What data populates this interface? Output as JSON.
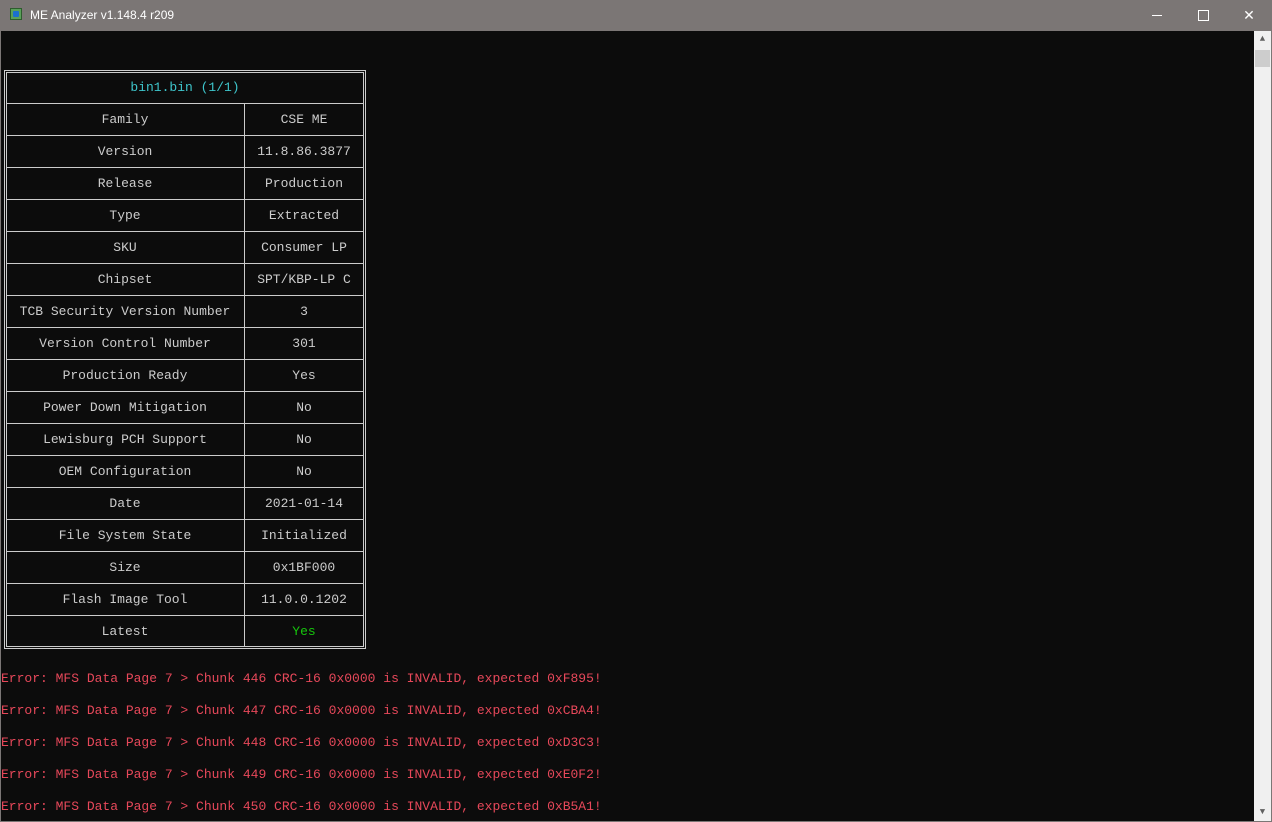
{
  "window": {
    "title": "ME Analyzer v1.148.4 r209"
  },
  "table": {
    "title": "bin1.bin (1/1)",
    "rows": [
      {
        "key": "Family",
        "value": "CSE ME"
      },
      {
        "key": "Version",
        "value": "11.8.86.3877"
      },
      {
        "key": "Release",
        "value": "Production"
      },
      {
        "key": "Type",
        "value": "Extracted"
      },
      {
        "key": "SKU",
        "value": "Consumer LP"
      },
      {
        "key": "Chipset",
        "value": "SPT/KBP-LP C"
      },
      {
        "key": "TCB Security Version Number",
        "value": "3"
      },
      {
        "key": "Version Control Number",
        "value": "301"
      },
      {
        "key": "Production Ready",
        "value": "Yes"
      },
      {
        "key": "Power Down Mitigation",
        "value": "No"
      },
      {
        "key": "Lewisburg PCH Support",
        "value": "No"
      },
      {
        "key": "OEM Configuration",
        "value": "No"
      },
      {
        "key": "Date",
        "value": "2021-01-14"
      },
      {
        "key": "File System State",
        "value": "Initialized"
      },
      {
        "key": "Size",
        "value": "0x1BF000"
      },
      {
        "key": "Flash Image Tool",
        "value": "11.0.0.1202"
      },
      {
        "key": "Latest",
        "value": "Yes"
      }
    ]
  },
  "errors": [
    "Error: MFS Data Page 7 > Chunk 446 CRC-16 0x0000 is INVALID, expected 0xF895!",
    "Error: MFS Data Page 7 > Chunk 447 CRC-16 0x0000 is INVALID, expected 0xCBA4!",
    "Error: MFS Data Page 7 > Chunk 448 CRC-16 0x0000 is INVALID, expected 0xD3C3!",
    "Error: MFS Data Page 7 > Chunk 449 CRC-16 0x0000 is INVALID, expected 0xE0F2!",
    "Error: MFS Data Page 7 > Chunk 450 CRC-16 0x0000 is INVALID, expected 0xB5A1!"
  ],
  "colors": {
    "title": "#3ec6cc",
    "error": "#e7485a",
    "latest": "#16c60c",
    "text": "#cccccc"
  }
}
